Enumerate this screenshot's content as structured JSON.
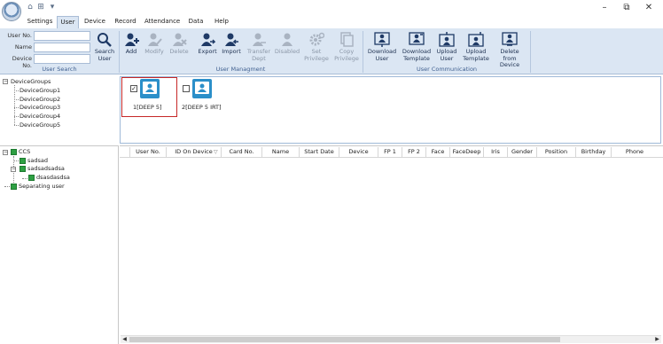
{
  "window": {
    "minimize": "–",
    "maximize": "⧉",
    "close": "✕"
  },
  "quick_access": [
    "⌂",
    "⊞",
    "▾"
  ],
  "tabs": [
    {
      "label": "Settings"
    },
    {
      "label": "User"
    },
    {
      "label": "Device"
    },
    {
      "label": "Record"
    },
    {
      "label": "Attendance"
    },
    {
      "label": "Data"
    },
    {
      "label": "Help"
    }
  ],
  "user_search": {
    "user_no_label": "User No.",
    "name_label": "Name",
    "device_no_label": "Device No.",
    "user_no_value": "",
    "name_value": "",
    "device_no_value": "",
    "search_button": "Search\nUser",
    "group_label": "User Search"
  },
  "user_management": {
    "group_label": "User Managment",
    "add": "Add",
    "modify": "Modify",
    "delete": "Delete",
    "export": "Export",
    "import": "Import",
    "transfer": "Transfer\nDept",
    "disabled": "Disabled",
    "set_privilege": "Set\nPrivilege",
    "copy_privilege": "Copy\nPrivilege"
  },
  "user_communication": {
    "group_label": "User Communication",
    "download_user": "Download\nUser",
    "download_template": "Download\nTemplate",
    "upload_user": "Upload\nUser",
    "upload_template": "Upload\nTemplate",
    "delete_from_device": "Delete from\nDevice"
  },
  "device_groups": {
    "root": "DeviceGroups",
    "items": [
      "DeviceGroup1",
      "DeviceGroup2",
      "DeviceGroup3",
      "DeviceGroup4",
      "DeviceGroup5"
    ]
  },
  "devices": [
    {
      "label": "1[DEEP 5]",
      "checked": true
    },
    {
      "label": "2[DEEP 5 IRT]",
      "checked": false
    }
  ],
  "org_tree": {
    "root": "CCS",
    "child1": "sadsad",
    "child2": "sadsadsadsa",
    "grandchild": "dsasdasdsa",
    "separate": "Separating user"
  },
  "grid_columns": [
    "User No.",
    "ID On Device",
    "Card No.",
    "Name",
    "Start Date",
    "Device",
    "FP 1",
    "FP 2",
    "Face",
    "FaceDeep",
    "Iris",
    "Gender",
    "Position",
    "Birthday",
    "Phone"
  ],
  "colors": {
    "ribbon_bg": "#dbe6f3",
    "accent_blue": "#2b8fc9",
    "selection_red": "#c62828",
    "tree_green": "#2ea043"
  }
}
